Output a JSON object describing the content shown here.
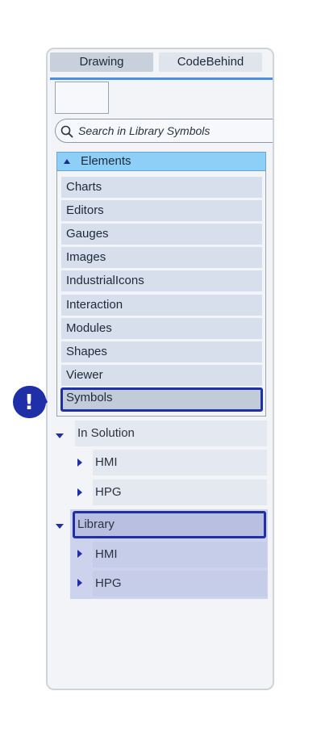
{
  "tabs": {
    "drawing": "Drawing",
    "codebehind": "CodeBehind"
  },
  "search": {
    "placeholder": "Search in Library Symbols"
  },
  "elements": {
    "header": "Elements",
    "items": [
      "Charts",
      "Editors",
      "Gauges",
      "Images",
      "IndustrialIcons",
      "Interaction",
      "Modules",
      "Shapes",
      "Viewer",
      "Symbols"
    ],
    "selected": "Symbols"
  },
  "badge": {
    "text": "!"
  },
  "tree": {
    "in_solution": {
      "label": "In Solution",
      "children": [
        "HMI",
        "HPG"
      ]
    },
    "library": {
      "label": "Library",
      "children": [
        "HMI",
        "HPG"
      ]
    }
  },
  "colors": {
    "accent": "#1f2fa8",
    "header_blue": "#8ecff8",
    "tab_line": "#4a90e2"
  }
}
